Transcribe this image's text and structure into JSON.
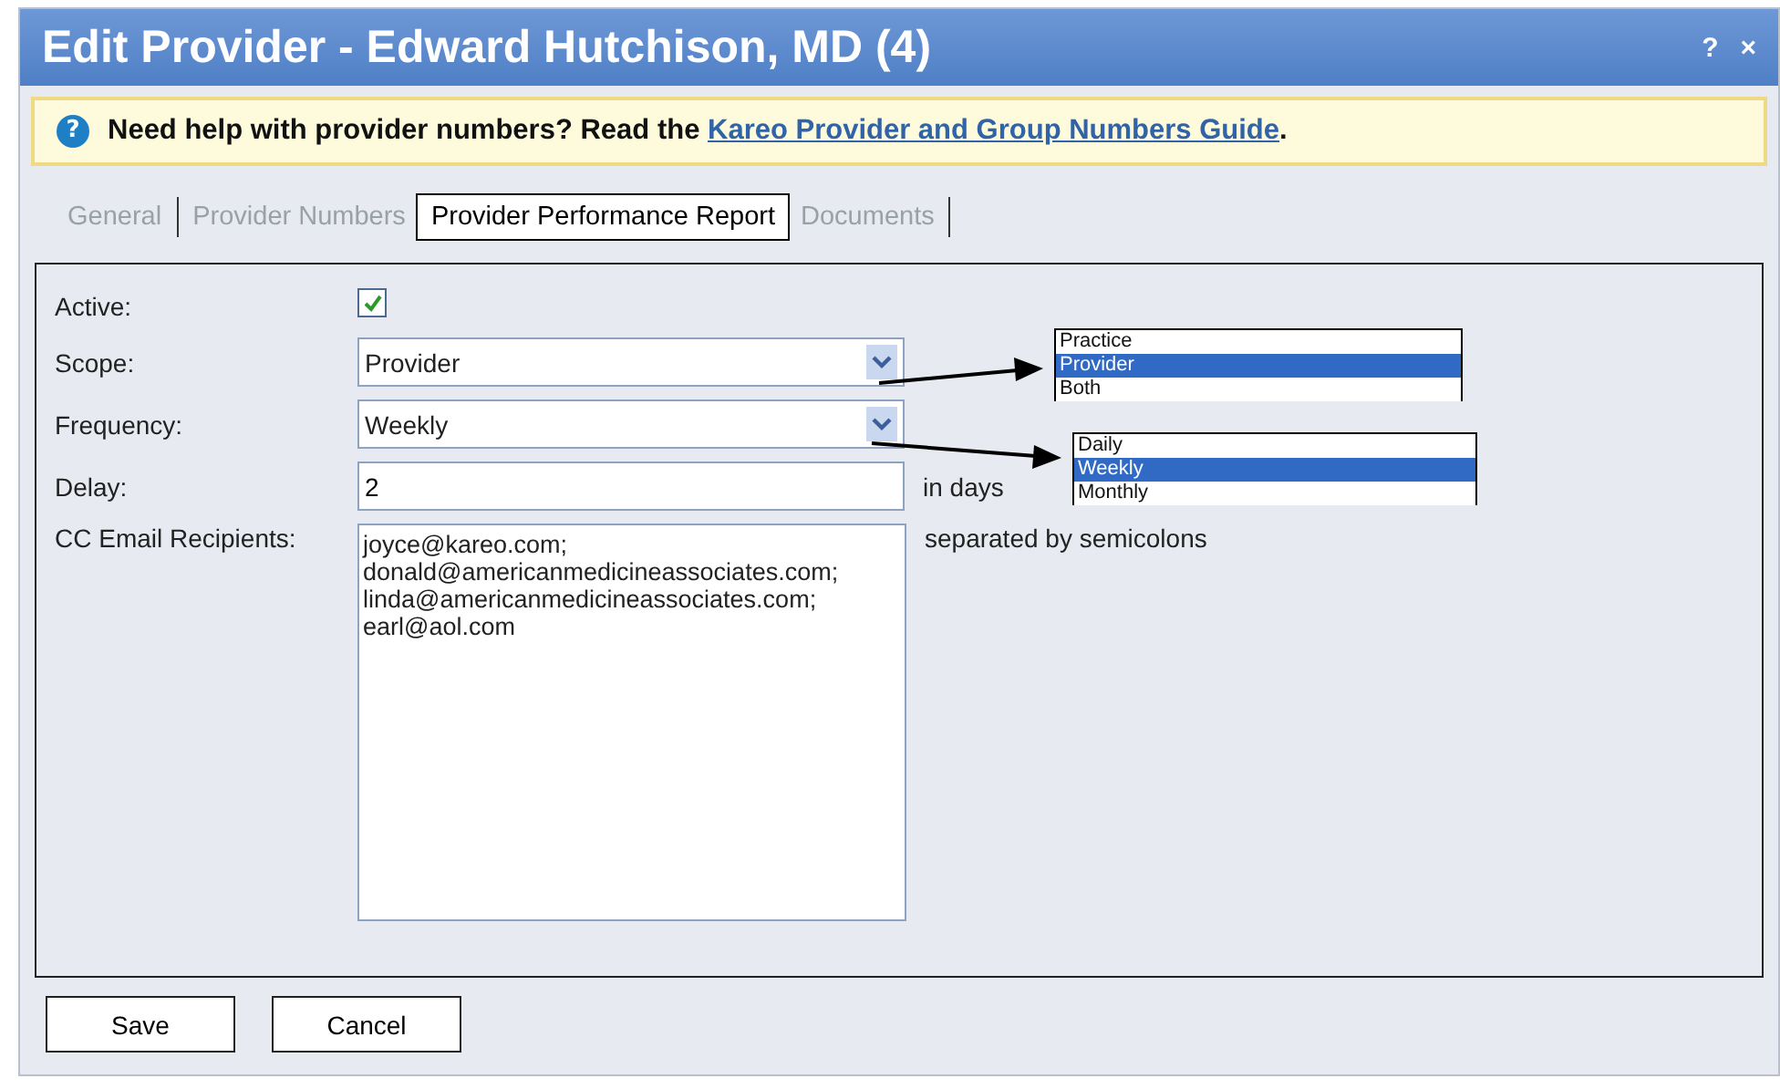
{
  "window": {
    "title": "Edit Provider - Edward Hutchison, MD (4)",
    "help_button": "?",
    "close_button": "×"
  },
  "help_banner": {
    "icon": "?",
    "text": "Need help with provider numbers? Read the",
    "link": "Kareo Provider and Group Numbers Guide",
    "after": "."
  },
  "tabs": [
    {
      "label": "General",
      "selected": false
    },
    {
      "label": "Provider Numbers",
      "selected": false
    },
    {
      "label": "Provider Performance Report",
      "selected": true
    },
    {
      "label": "Documents",
      "selected": false
    }
  ],
  "form": {
    "active": {
      "label": "Active:",
      "checked": true
    },
    "scope": {
      "label": "Scope:",
      "value": "Provider",
      "options": [
        {
          "label": "Practice",
          "selected": false
        },
        {
          "label": "Provider",
          "selected": true
        },
        {
          "label": "Both",
          "selected": false
        }
      ]
    },
    "frequency": {
      "label": "Frequency:",
      "value": "Weekly",
      "options": [
        {
          "label": "Daily",
          "selected": false
        },
        {
          "label": "Weekly",
          "selected": true
        },
        {
          "label": "Monthly",
          "selected": false
        }
      ]
    },
    "delay": {
      "label": "Delay:",
      "value": "2",
      "unit": "in days"
    },
    "cc_email": {
      "label": "CC Email Recipients:",
      "value": "joyce@kareo.com;\ndonald@americanmedicineassociates.com;\nlinda@americanmedicineassociates.com;\nearl@aol.com",
      "hint": "separated by semicolons"
    }
  },
  "buttons": [
    "Save",
    "Cancel"
  ]
}
